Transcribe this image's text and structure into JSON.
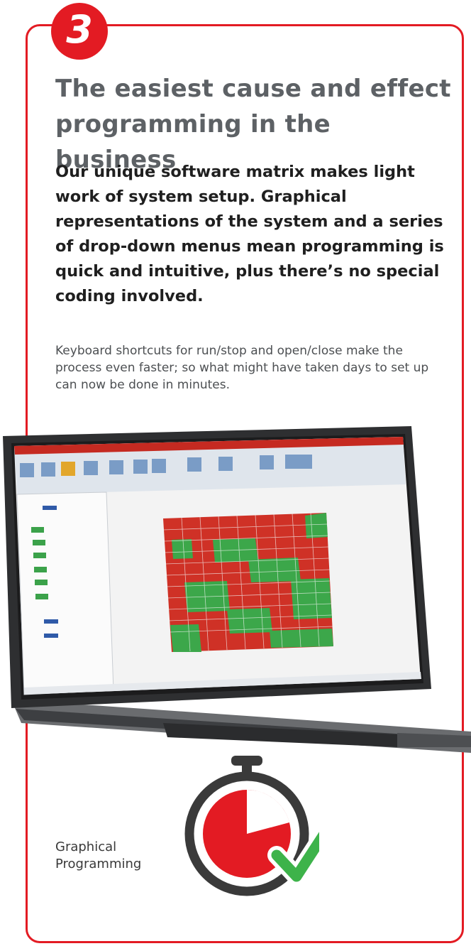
{
  "badge": {
    "number": "3"
  },
  "headline": "The easiest cause and effect programming in the business",
  "lead": "Our unique software matrix makes light work of system setup. Graphical representations of the system and a series of drop-down menus mean programming is quick and intuitive, plus there’s no special coding involved.",
  "body": "Keyboard shortcuts for run/stop and open/close make the process even faster; so what might have taken days to set up can now be done in minutes.",
  "caption": {
    "line1": "Graphical",
    "line2": "Programming"
  },
  "colors": {
    "accent": "#e31b23",
    "headline": "#5d6165",
    "check": "#3db34a",
    "timer": "#3a3a3a"
  },
  "icons": {
    "badge": "number-badge",
    "timer": "stopwatch-check-icon"
  }
}
